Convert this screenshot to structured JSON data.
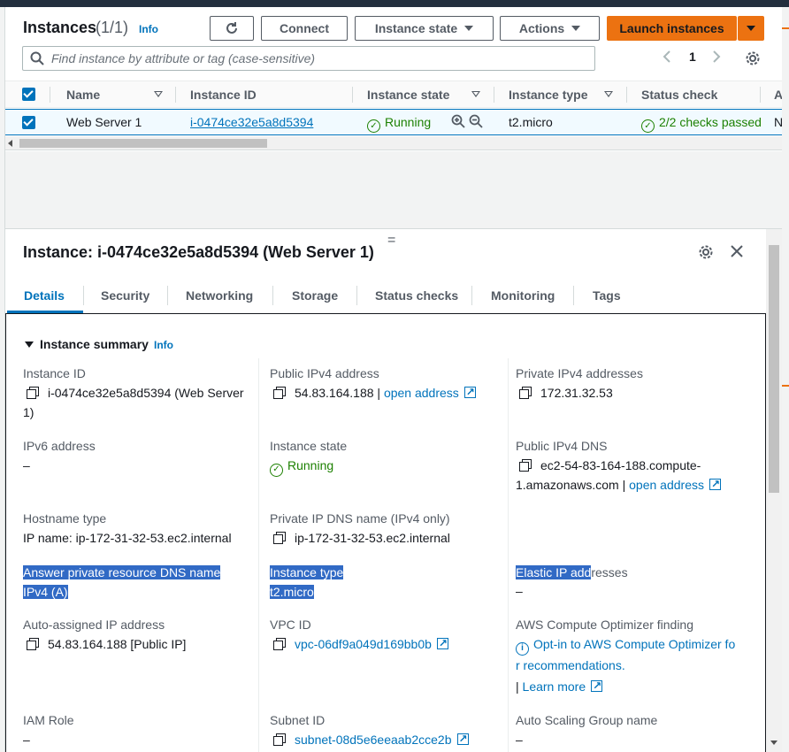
{
  "header": {
    "title": "Instances",
    "count": "(1/1)",
    "info": "Info",
    "connect": "Connect",
    "instance_state": "Instance state",
    "actions": "Actions",
    "launch": "Launch instances"
  },
  "search": {
    "placeholder": "Find instance by attribute or tag (case-sensitive)"
  },
  "pagination": {
    "page": "1"
  },
  "table": {
    "columns": [
      "Name",
      "Instance ID",
      "Instance state",
      "Instance type",
      "Status check",
      "A"
    ],
    "row": {
      "name": "Web Server 1",
      "instance_id": "i-0474ce32e5a8d5394",
      "state": "Running",
      "type": "t2.micro",
      "status_check": "2/2 checks passed",
      "extra": "N"
    }
  },
  "detail": {
    "drag_handle": "=",
    "title": "Instance: i-0474ce32e5a8d5394 (Web Server 1)",
    "tabs": [
      "Details",
      "Security",
      "Networking",
      "Storage",
      "Status checks",
      "Monitoring",
      "Tags"
    ],
    "section_title": "Instance summary",
    "section_info": "Info",
    "fields": {
      "instance_id_label": "Instance ID",
      "instance_id_value_1": "i-0474ce32e5a8d5394 (Web Server",
      "instance_id_value_2": "1)",
      "public_ipv4_label": "Public IPv4 address",
      "public_ipv4_value": "54.83.164.188",
      "public_ipv4_sep": "|",
      "open_address": "open address",
      "private_ipv4_label": "Private IPv4 addresses",
      "private_ipv4_value": "172.31.32.53",
      "ipv6_label": "IPv6 address",
      "ipv6_value": "–",
      "state_label": "Instance state",
      "state_value": "Running",
      "public_dns_label": "Public IPv4 DNS",
      "public_dns_value_1": "ec2-54-83-164-188.compute-",
      "public_dns_value_2": "1.amazonaws.com",
      "public_dns_sep": "|",
      "hostname_label": "Hostname type",
      "hostname_value": "IP name: ip-172-31-32-53.ec2.internal",
      "private_dns_label": "Private IP DNS name (IPv4 only)",
      "private_dns_value": "ip-172-31-32-53.ec2.internal",
      "answer_dns_label_1": "Answer private resource DNS name",
      "answer_dns_label_2": "IPv4 (A)",
      "instance_type_label": "Instance type",
      "instance_type_value": "t2.micro",
      "elastic_ip_label_sel": "Elastic IP add",
      "elastic_ip_label_rest": "resses",
      "elastic_ip_value": "–",
      "auto_ip_label": "Auto-assigned IP address",
      "auto_ip_value": "54.83.164.188 [Public IP]",
      "vpc_label": "VPC ID",
      "vpc_value": "vpc-06df9a049d169bb0b",
      "optimizer_label": "AWS Compute Optimizer finding",
      "optimizer_value_1": "Opt-in to AWS Compute Optimizer fo",
      "optimizer_value_2": "r recommendations.",
      "learn_sep": "|",
      "learn_more": "Learn more",
      "iam_label": "IAM Role",
      "iam_value": "–",
      "subnet_label": "Subnet ID",
      "subnet_value": "subnet-08d5e6eeaab2cce2b",
      "asg_label": "Auto Scaling Group name",
      "asg_value": "–"
    }
  },
  "colors": {
    "accent": "#0073bb",
    "primary_button": "#ec7211",
    "success": "#1d8102",
    "selection": "#316ac5"
  }
}
